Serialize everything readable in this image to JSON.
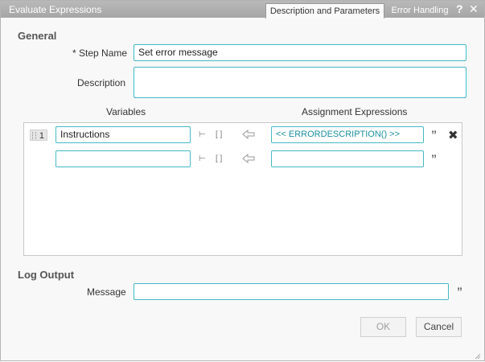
{
  "window": {
    "title": "Evaluate Expressions",
    "tabs": [
      {
        "label": "Description and Parameters"
      },
      {
        "label": "Error Handling"
      }
    ],
    "help_glyph": "?",
    "close_glyph": "✕"
  },
  "general": {
    "heading": "General",
    "step_name_label": "* Step Name",
    "step_name_value": "Set error message",
    "description_label": "Description",
    "description_value": ""
  },
  "grid": {
    "variables_header": "Variables",
    "expressions_header": "Assignment Expressions",
    "rows": [
      {
        "number": "1",
        "variable": "Instructions",
        "expression": "<< ERRORDESCRIPTION() >>"
      },
      {
        "number": "",
        "variable": "",
        "expression": ""
      }
    ]
  },
  "log_output": {
    "heading": "Log Output",
    "message_label": "Message",
    "message_value": ""
  },
  "buttons": {
    "ok": "OK",
    "cancel": "Cancel"
  },
  "glyphs": {
    "quote": "”",
    "delete": "✖",
    "brackets": "[ ]",
    "tree": "⊢"
  },
  "colors": {
    "field_border": "#45b9c6",
    "titlebar": "#a6a6a6"
  }
}
